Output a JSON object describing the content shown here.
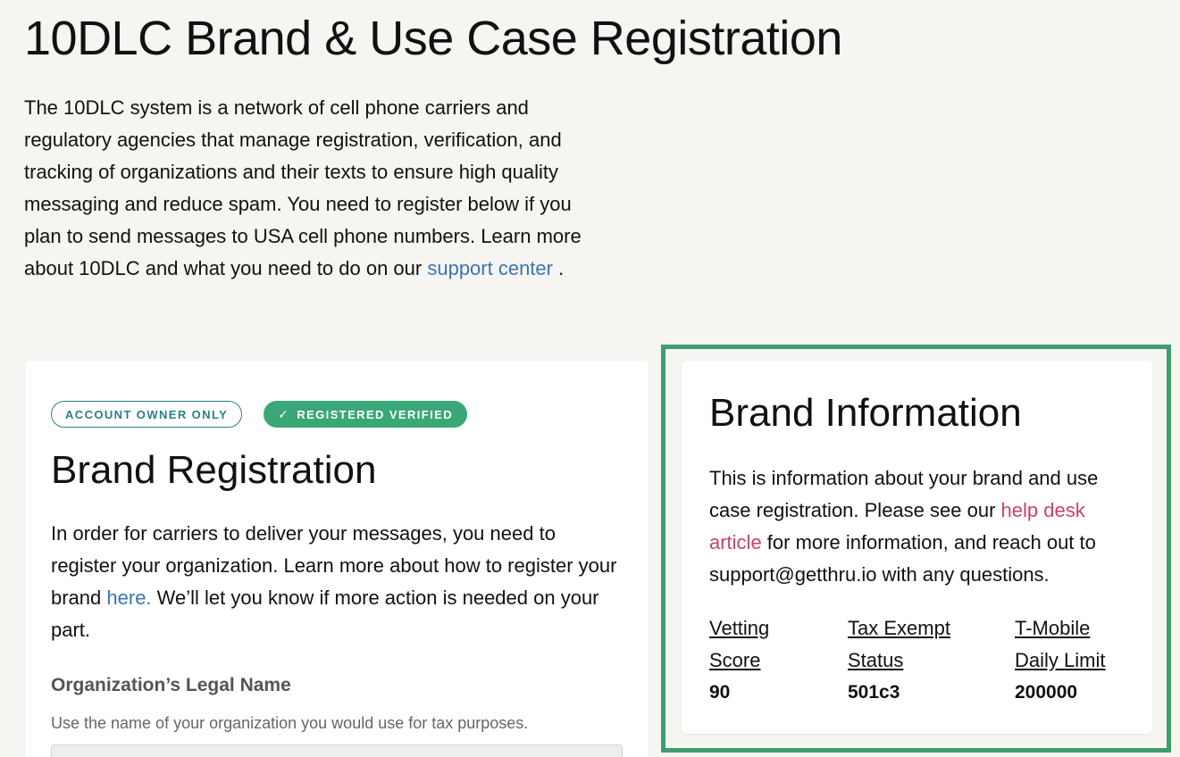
{
  "page": {
    "title": "10DLC Brand & Use Case Registration",
    "intro_text": "The 10DLC system is a network of cell phone carriers and regulatory agencies that manage registration, verification, and tracking of organizations and their texts to ensure high quality messaging and reduce spam. You need to register below if you plan to send messages to USA cell phone numbers. Learn more about 10DLC and what you need to do on our ",
    "intro_link": "support center",
    "intro_end": " ."
  },
  "brand_registration": {
    "badge_owner": "ACCOUNT OWNER ONLY",
    "badge_check": "✓",
    "badge_status": "REGISTERED VERIFIED",
    "title": "Brand Registration",
    "text_before_link": "In order for carriers to deliver your messages, you need to register your organization. Learn more about how to register your brand ",
    "link": "here.",
    "text_after_link": " We’ll let you know if more action is needed on your part.",
    "field_label": "Organization’s Legal Name",
    "field_help": "Use the name of your organization you would use for tax purposes.",
    "field_value": ""
  },
  "brand_information": {
    "title": "Brand Information",
    "text_before_link": "This is information about your brand and use case registration. Please see our ",
    "link": "help desk article",
    "text_after_link": " for more information, and reach out to support@getthru.io with any questions.",
    "stats": [
      {
        "label_line1": "Vetting",
        "label_line2": "Score",
        "value": "90"
      },
      {
        "label_line1": "Tax Exempt",
        "label_line2": "Status",
        "value": "501c3"
      },
      {
        "label_line1": "T-Mobile",
        "label_line2": "Daily Limit",
        "value": "200000"
      }
    ]
  },
  "colors": {
    "background": "#f6f5f1",
    "link_blue": "#3a73b8",
    "link_pink": "#c8426a",
    "badge_teal": "#2a7f8a",
    "badge_green": "#3aa876",
    "highlight_green": "#3e9e6e"
  }
}
